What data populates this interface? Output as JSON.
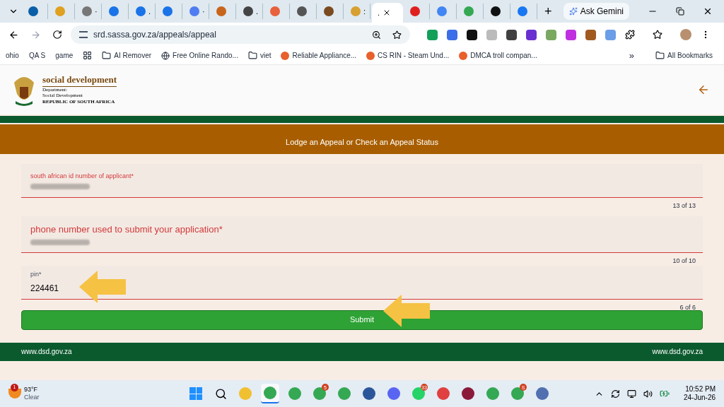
{
  "browser": {
    "tabs": [
      {
        "color": "#0b5fa8",
        "selected": false
      },
      {
        "color": "#e0a020",
        "selected": false
      },
      {
        "title": "·",
        "color": "#777777",
        "selected": false
      },
      {
        "color": "#1a73e8",
        "selected": false
      },
      {
        "title": ".",
        "color": "#1a73e8",
        "selected": false
      },
      {
        "color": "#1a73e8",
        "selected": false
      },
      {
        "title": "·",
        "color": "#4f7cf0",
        "selected": false
      },
      {
        "color": "#c8651a",
        "selected": false
      },
      {
        "title": ".",
        "color": "#444444",
        "selected": false
      },
      {
        "color": "#e8603c",
        "selected": false
      },
      {
        "color": "#555555",
        "selected": false
      },
      {
        "color": "#7a4a20",
        "selected": false
      },
      {
        "title": ":",
        "color": "#d8a030",
        "selected": false
      },
      {
        "title": ".",
        "selected": true
      },
      {
        "color": "#e02020",
        "selected": false
      },
      {
        "color": "#4285f4",
        "selected": false
      },
      {
        "color": "#34a853",
        "selected": false
      },
      {
        "color": "#111111",
        "selected": false
      },
      {
        "color": "#1877f2",
        "selected": false
      }
    ],
    "new_tab": "+",
    "ask_button": "Ask Gemini",
    "url": "srd.sassa.gov.za/appeals/appeal",
    "extensions": [
      {
        "color": "#15a05a"
      },
      {
        "color": "#3b6ee8"
      },
      {
        "color": "#111111"
      },
      {
        "color": "#bbbbbb"
      },
      {
        "color": "#404040"
      },
      {
        "color": "#6a2fd0"
      },
      {
        "color": "#7aa860"
      },
      {
        "color": "#c030e0"
      },
      {
        "color": "#a05a20"
      },
      {
        "color": "#6a9ee8"
      }
    ],
    "bookmarks": [
      {
        "kind": "text",
        "label": "ohio"
      },
      {
        "kind": "text",
        "label": "QA S"
      },
      {
        "kind": "text",
        "label": "game"
      },
      {
        "kind": "apps"
      },
      {
        "kind": "folder",
        "label": "AI Remover"
      },
      {
        "kind": "globe",
        "label": "Free Online Rando..."
      },
      {
        "kind": "folder",
        "label": "viet"
      },
      {
        "kind": "site",
        "label": "Reliable Appliance..."
      },
      {
        "kind": "site",
        "label": "CS RIN - Steam Und..."
      },
      {
        "kind": "site",
        "label": "DMCA troll compan..."
      }
    ],
    "more": "»",
    "all_bookmarks": "All Bookmarks"
  },
  "page": {
    "logo": {
      "title": "social development",
      "line_1": "Department:",
      "line_2": "Social Development",
      "line_3": "REPUBLIC OF SOUTH AFRICA"
    },
    "banner": "Lodge an Appeal or Check an Appeal Status",
    "fields": [
      {
        "kind": "floated",
        "label": "south african id number of applicant*",
        "error": true,
        "value_hidden": true,
        "counter": "13 of 13"
      },
      {
        "kind": "resting",
        "label": "phone number used to submit your application*",
        "error": true,
        "value_hidden": true,
        "counter": "10 of 10"
      },
      {
        "kind": "floated",
        "label": "pin*",
        "error": false,
        "value": "224461",
        "value_hidden": false,
        "counter": "6 of 6"
      }
    ],
    "submit": "Submit",
    "footer_left": "www.dsd.gov.za",
    "footer_right": "www.dsd.gov.za"
  },
  "taskbar": {
    "weather": {
      "badge": "1",
      "temp": "93°F",
      "condition": "Clear"
    },
    "apps": [
      {
        "selected": false,
        "kind": "windows"
      },
      {
        "selected": false,
        "kind": "search"
      },
      {
        "color": "#f0c030",
        "selected": false,
        "kind": "app"
      },
      {
        "color": "#34a853",
        "selected": true,
        "kind": "app"
      },
      {
        "color": "#34a853",
        "selected": false,
        "kind": "app"
      },
      {
        "color": "#34a853",
        "badge": "5",
        "selected": false,
        "kind": "app"
      },
      {
        "color": "#34a853",
        "selected": false,
        "kind": "app"
      },
      {
        "color": "#2b579a",
        "selected": false,
        "kind": "app"
      },
      {
        "color": "#5865f2",
        "selected": false,
        "kind": "app"
      },
      {
        "color": "#25d366",
        "badge": "33",
        "selected": false,
        "kind": "app"
      },
      {
        "color": "#e04040",
        "selected": false,
        "kind": "app"
      },
      {
        "color": "#8b1a3a",
        "selected": false,
        "kind": "app"
      },
      {
        "color": "#34a853",
        "selected": false,
        "kind": "app"
      },
      {
        "color": "#34a853",
        "badge": "S",
        "selected": false,
        "kind": "app"
      },
      {
        "color": "#5070b0",
        "selected": false,
        "kind": "app"
      }
    ],
    "time": "10:52 PM",
    "date": "24-Jun-26"
  }
}
